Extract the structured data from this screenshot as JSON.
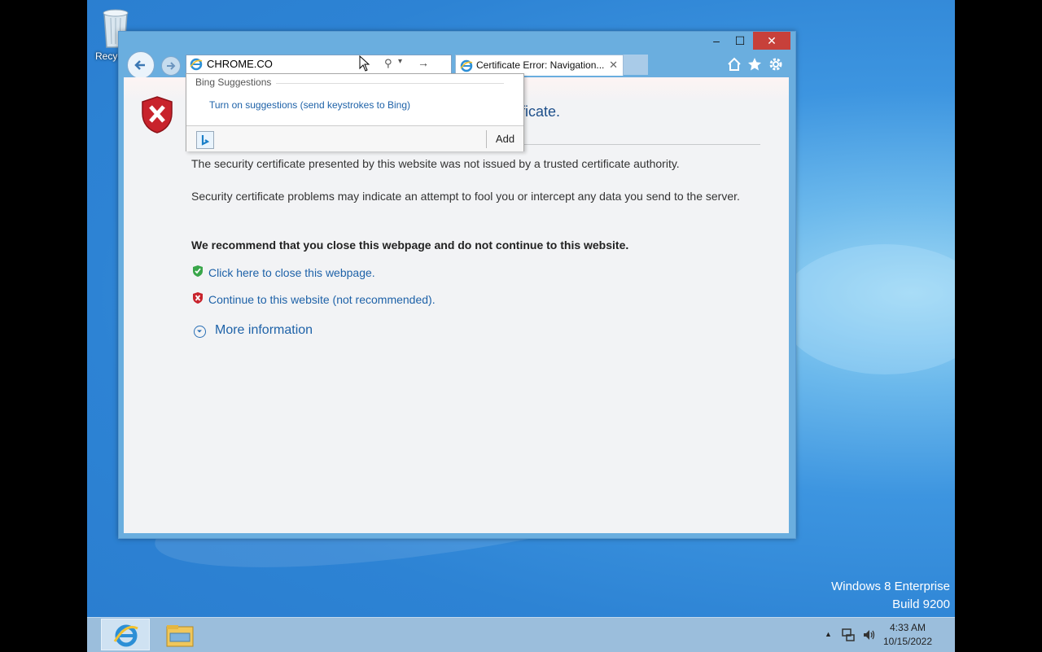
{
  "desktop": {
    "recycle_bin_label": "Recyc",
    "watermark_line1": "Windows 8 Enterprise",
    "watermark_line2": "Build 9200"
  },
  "browser": {
    "address_value": "CHROME.CO",
    "tab_title": "Certificate Error: Navigation...",
    "tab_close": "✕",
    "caption": {
      "minimize": "–",
      "maximize": "☐",
      "close": "✕"
    }
  },
  "suggestions": {
    "header": "Bing Suggestions",
    "turn_on_link": "Turn on suggestions (send keystrokes to Bing)",
    "add_button": "Add"
  },
  "page": {
    "heading_partial": "ificate.",
    "para1": "The security certificate presented by this website was not issued by a trusted certificate authority.",
    "para2": "Security certificate problems may indicate an attempt to fool you or intercept any data you send to the server.",
    "recommend": "We recommend that you close this webpage and do not continue to this website.",
    "close_link": "Click here to close this webpage.",
    "continue_link": "Continue to this website (not recommended).",
    "more_info": "More information"
  },
  "taskbar": {
    "time": "4:33 AM",
    "date": "10/15/2022"
  },
  "icons": [
    "recycle-bin-icon",
    "back-icon",
    "forward-icon",
    "ie-icon",
    "search-icon",
    "go-icon",
    "home-icon",
    "favorites-icon",
    "gear-icon",
    "shield-error-icon",
    "green-shield-icon",
    "red-shield-icon",
    "expand-icon",
    "bing-icon",
    "explorer-icon",
    "network-icon",
    "volume-icon",
    "tray-arrow-icon"
  ]
}
